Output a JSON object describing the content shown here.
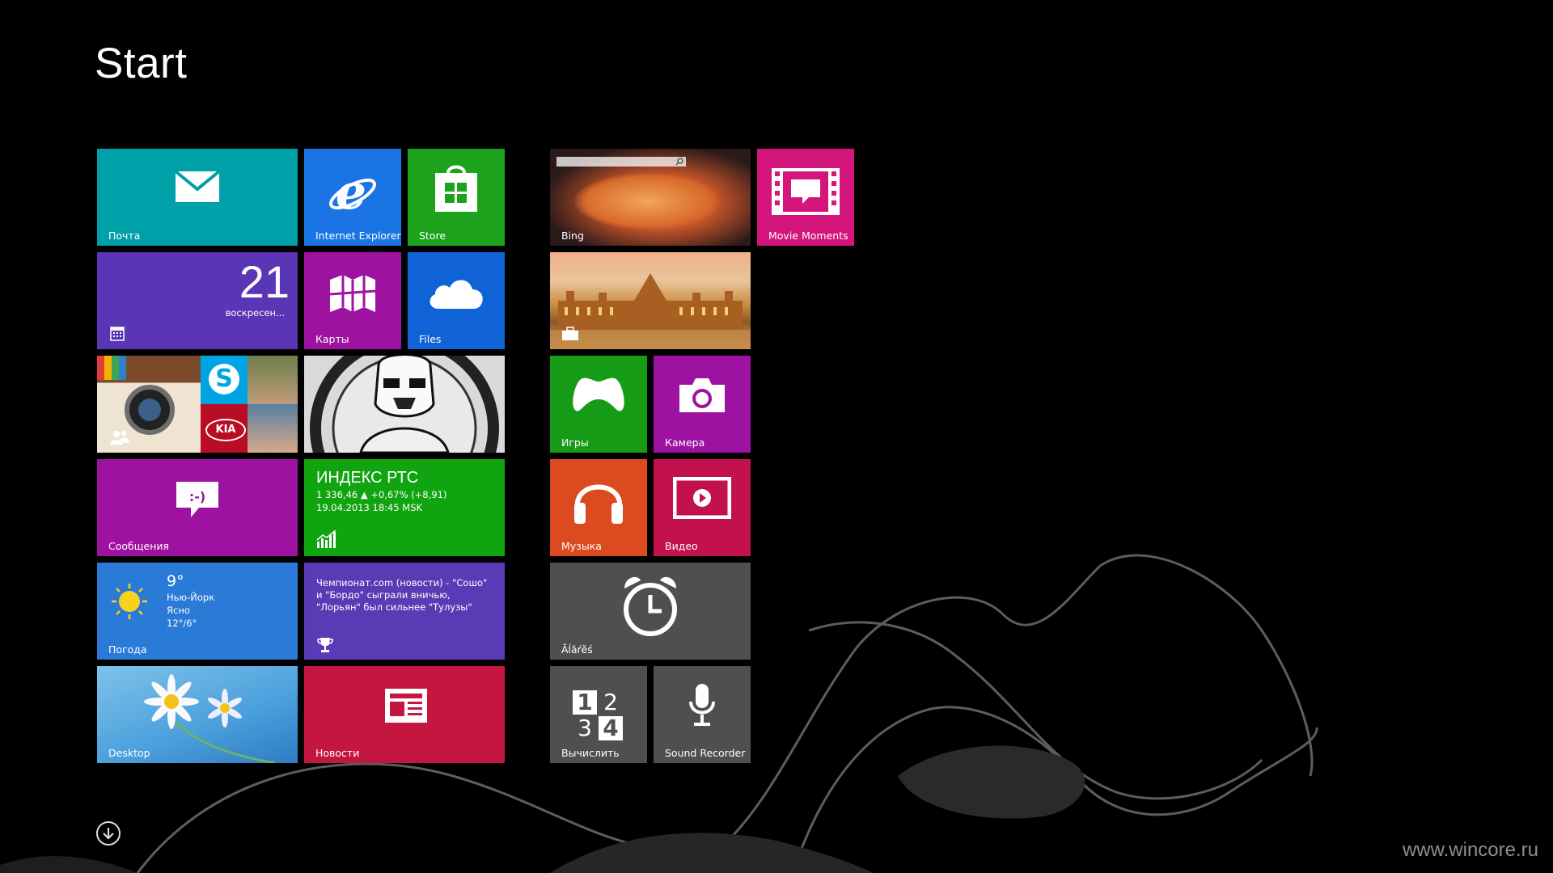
{
  "screen": {
    "title": "Start",
    "watermark": "www.wincore.ru"
  },
  "tiles": {
    "mail": {
      "label": "Почта"
    },
    "ie": {
      "label": "Internet Explorer"
    },
    "store": {
      "label": "Store"
    },
    "calendar": {
      "day": "21",
      "weekday": "воскресен..."
    },
    "maps": {
      "label": "Карты"
    },
    "files": {
      "label": "Files"
    },
    "messages": {
      "label": "Сообщения"
    },
    "finance": {
      "title": "ИНДЕКС РТС",
      "line1": "1 336,46 ▲ +0,67% (+8,91)",
      "line2": "19.04.2013 18:45 MSK"
    },
    "weather": {
      "temp": "9°",
      "city": "Нью-Йорк",
      "cond": "Ясно",
      "range": "12°/6°",
      "label": "Погода"
    },
    "sports": {
      "text": "Чемпионат.com (новости) - \"Сошо\" и \"Бордо\" сыграли вничью, \"Лорьян\" был сильнее \"Тулузы\""
    },
    "desktop": {
      "label": "Desktop"
    },
    "news": {
      "label": "Новости"
    },
    "bing": {
      "label": "Bing"
    },
    "movie": {
      "label": "Movie Moments"
    },
    "games": {
      "label": "Игры"
    },
    "camera": {
      "label": "Камера"
    },
    "music": {
      "label": "Музыка"
    },
    "video": {
      "label": "Видео"
    },
    "alarms": {
      "label": "Ăĺăŕěś"
    },
    "calc": {
      "label": "Вычислить",
      "d1": "1",
      "d2": "2",
      "d3": "3",
      "d4": "4"
    },
    "recorder": {
      "label": "Sound Recorder"
    }
  },
  "colors": {
    "teal": "#00a0a8",
    "blue": "#1b74e4",
    "green": "#1ca21c",
    "purple": "#5a35b6",
    "violet": "#9e12a2",
    "magenta": "#d4157c",
    "orange": "#dc4a1f",
    "crimson": "#c3114f",
    "grey": "#4f4f4f",
    "red": "#c5163f"
  },
  "icons": {
    "allapps": "arrow-down-circle-icon"
  }
}
